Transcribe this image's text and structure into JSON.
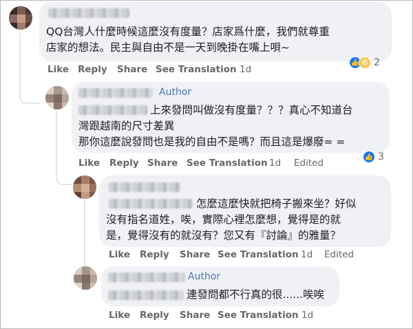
{
  "comments": [
    {
      "author_badge": "",
      "lines": [
        "QQ台灣人什麼時候這麼沒有度量？店家爲什麼，我們就尊重",
        "店家的想法。民主與自由不是一天到晚掛在嘴上唄~"
      ],
      "actions": {
        "like": "Like",
        "reply": "Reply",
        "share": "Share",
        "translate": "See Translation",
        "time": "1d",
        "edited": ""
      },
      "reaction_count": "2",
      "reactions": [
        "like-icon",
        "haha-icon"
      ]
    },
    {
      "author_badge": "Author",
      "lines": [
        "上來發問叫做沒有度量？？？真心不知道台",
        "灣跟越南的尺寸差異",
        "那你這麼說發問也是我的自由不是嗎？而且這是爆廢= ="
      ],
      "actions": {
        "like": "Like",
        "reply": "Reply",
        "share": "Share",
        "translate": "See Translation",
        "time": "1d",
        "edited": "Edited"
      },
      "reaction_count": "3",
      "reactions": [
        "like-icon"
      ]
    },
    {
      "author_badge": "",
      "lines": [
        "怎麼這麼快就把椅子搬來坐？好似",
        "沒有指名道姓，唉，實際心裡怎麼想，覺得是的就",
        "是，覺得沒有的就沒有？您又有『討論』的雅量？"
      ],
      "actions": {
        "like": "Like",
        "reply": "Reply",
        "share": "Share",
        "translate": "See Translation",
        "time": "1d",
        "edited": "Edited"
      },
      "reaction_count": "",
      "reactions": []
    },
    {
      "author_badge": "Author",
      "lines": [
        "連發問都不行真的很......唉唉"
      ],
      "actions": {
        "like": "Like",
        "reply": "Reply",
        "share": "Share",
        "translate": "See Translation",
        "time": "1d",
        "edited": ""
      },
      "reaction_count": "",
      "reactions": []
    }
  ],
  "colors": {
    "bubble": "#eff1f4",
    "action_text": "#65676b",
    "author_badge": "#4c74b9",
    "like_blue": "#1877f2"
  }
}
